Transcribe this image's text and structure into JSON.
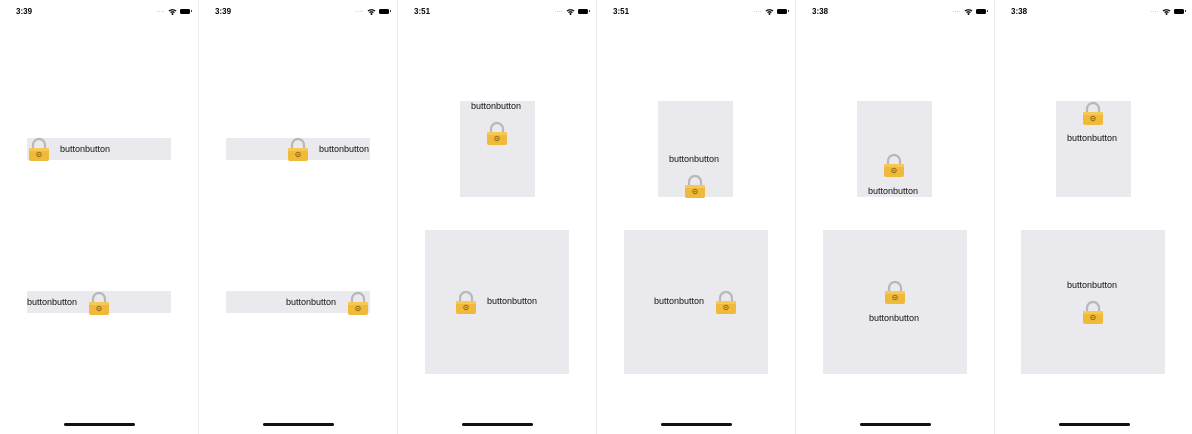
{
  "phones": [
    {
      "time": "3:39",
      "signal": "....",
      "buttons": [
        {
          "label": "buttonbutton"
        },
        {
          "label": "buttonbutton"
        }
      ]
    },
    {
      "time": "3:39",
      "signal": "....",
      "buttons": [
        {
          "label": "buttonbutton"
        },
        {
          "label": "buttonbutton"
        }
      ]
    },
    {
      "time": "3:51",
      "signal": "....",
      "buttons": [
        {
          "label": "buttonbutton"
        },
        {
          "label": "buttonbutton"
        }
      ]
    },
    {
      "time": "3:51",
      "signal": "....",
      "buttons": [
        {
          "label": "buttonbutton"
        },
        {
          "label": "buttonbutton"
        }
      ]
    },
    {
      "time": "3:38",
      "signal": "....",
      "buttons": [
        {
          "label": "buttonbutton"
        },
        {
          "label": "buttonbutton"
        }
      ]
    },
    {
      "time": "3:38",
      "signal": "....",
      "buttons": [
        {
          "label": "buttonbutton"
        },
        {
          "label": "buttonbutton"
        }
      ]
    }
  ],
  "colors": {
    "button_background": "#e9e9ee",
    "lock_body": "#f0b93a",
    "lock_shackle": "#b8b8b8"
  },
  "icons": {
    "button_image": "lock-icon",
    "status": [
      "signal-icon",
      "wifi-icon",
      "battery-icon"
    ]
  }
}
